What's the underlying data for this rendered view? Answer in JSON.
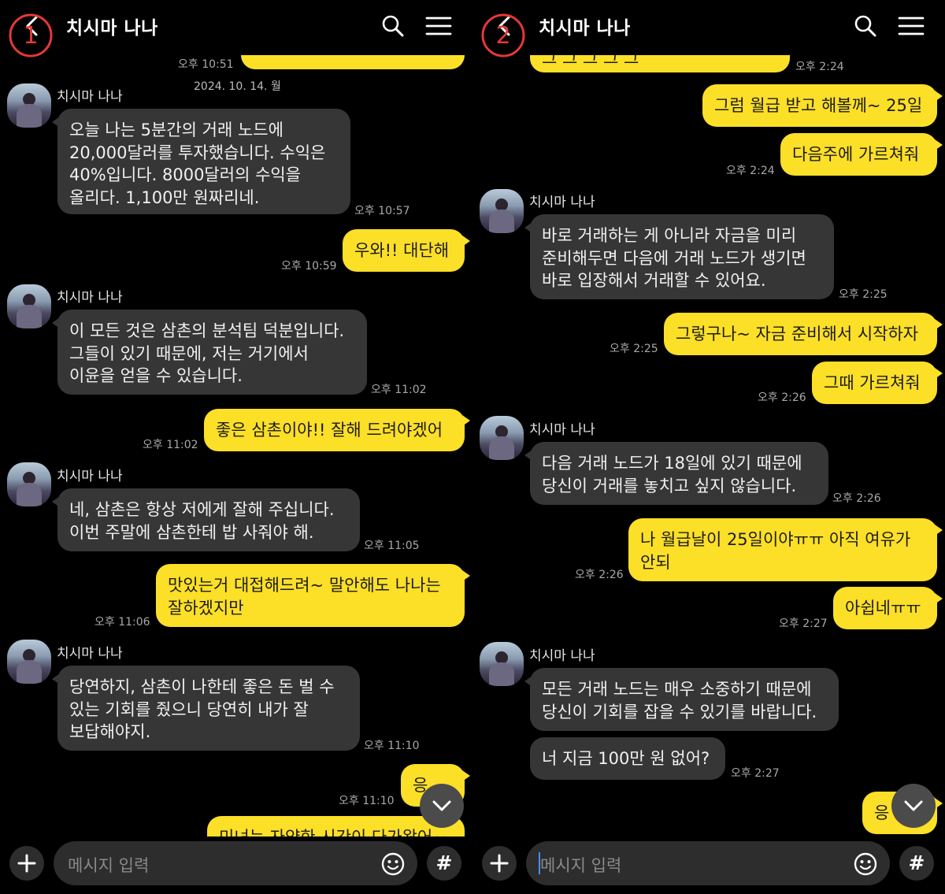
{
  "colors": {
    "background": "#000000",
    "incoming_bubble": "#363636",
    "outgoing_bubble": "#fcdf27",
    "marker": "#e53935"
  },
  "panel1": {
    "marker": "①",
    "title": "치시마 나나",
    "top_time": "오후 10:51",
    "date_separator": "2024. 10. 14. 월",
    "messages": [
      {
        "sender": "치시마 나나",
        "text": "오늘 나는 5분간의 거래 노드에\n20,000달러를 투자했습니다. 수익은\n40%입니다. 8000달러의 수익을\n올리다. 1,100만 원짜리네.",
        "time": "오후 10:57"
      },
      {
        "text": "우와!! 대단해",
        "time": "오후 10:59"
      },
      {
        "sender": "치시마 나나",
        "text": "이 모든 것은 삼촌의 분석팀 덕분입니다.\n그들이 있기 때문에, 저는 거기에서\n이윤을 얻을 수 있습니다.",
        "time": "오후 11:02"
      },
      {
        "text": "좋은 삼촌이야!! 잘해 드려야겠어",
        "time": "오후 11:02"
      },
      {
        "sender": "치시마 나나",
        "text": "네, 삼촌은 항상 저에게 잘해 주십니다.\n이번 주말에 삼촌한테 밥 사줘야 해.",
        "time": "오후 11:05"
      },
      {
        "text": "맛있는거 대접해드려~ 말안해도 나나는\n잘하겠지만",
        "time": "오후 11:06"
      },
      {
        "sender": "치시마 나나",
        "text": "당연하지, 삼촌이 나한테 좋은 돈 벌 수\n있는 기회를 줬으니 당연히 내가 잘\n보답해야지.",
        "time": "오후 11:10"
      },
      {
        "text": "응",
        "time": "오후 11:10"
      },
      {
        "text": "미녀는 자약한 시간이 다가왔어~"
      }
    ],
    "input_placeholder": "메시지 입력",
    "hash_label": "#"
  },
  "panel2": {
    "marker": "②",
    "title": "치시마 나나",
    "messages": [
      {
        "text": "그 그 그 그 그",
        "time": "오후 2:24"
      },
      {
        "text": "그럼 월급 받고 해볼께~ 25일"
      },
      {
        "text": "다음주에 가르쳐줘",
        "time": "오후 2:24"
      },
      {
        "sender": "치시마 나나",
        "text": "바로 거래하는 게 아니라 자금을 미리\n준비해두면 다음에 거래 노드가 생기면\n바로 입장해서 거래할 수 있어요.",
        "time": "오후 2:25"
      },
      {
        "text": "그렇구나~ 자금 준비해서 시작하자",
        "time": "오후 2:25"
      },
      {
        "text": "그때 가르쳐줘",
        "time": "오후 2:26"
      },
      {
        "sender": "치시마 나나",
        "text": "다음 거래 노드가 18일에 있기 때문에\n당신이 거래를 놓치고 싶지 않습니다.",
        "time": "오후 2:26"
      },
      {
        "text": "나 월급날이 25일이야ㅠㅠ 아직 여유가\n안되",
        "time": "오후 2:26"
      },
      {
        "text": "아쉽네ㅠㅠ",
        "time": "오후 2:27"
      },
      {
        "sender": "치시마 나나",
        "text": "모든 거래 노드는 매우 소중하기 때문에\n당신이 기회를 잡을 수 있기를 바랍니다."
      },
      {
        "text": "너 지금 100만 원 없어?",
        "time": "오후 2:27"
      },
      {
        "text": "응"
      }
    ],
    "input_placeholder": "메시지 입력",
    "hash_label": "#"
  },
  "icons": {
    "back": "back-arrow-icon",
    "search": "search-icon",
    "menu": "hamburger-menu-icon",
    "plus": "plus-icon",
    "emoji": "emoji-icon",
    "scroll": "chevron-down-icon",
    "hash": "hash-icon"
  }
}
